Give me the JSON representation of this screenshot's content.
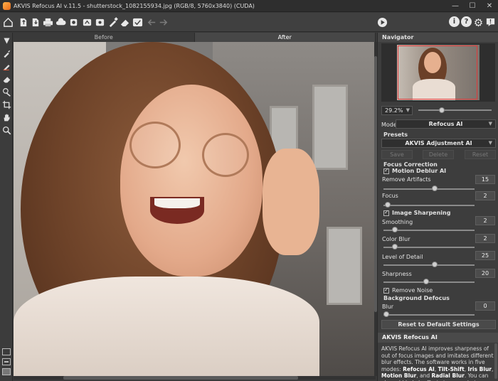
{
  "window": {
    "title": "AKVIS Refocus AI v.11.5 - shutterstock_1082155934.jpg (RGB/8, 5760x3840) (CUDA)",
    "min_glyph": "—",
    "max_glyph": "☐",
    "close_glyph": "✕"
  },
  "toolbar": {
    "icons": [
      "home-icon",
      "open-file-icon",
      "save-file-icon",
      "print-icon",
      "cloud-upload-icon",
      "batch-icon",
      "plugin-icon",
      "preferences-icon",
      "brush-icon",
      "eraser-icon",
      "check-icon",
      "undo-icon",
      "redo-icon",
      "run-icon"
    ],
    "help_buttons": [
      "i",
      "?"
    ],
    "settings_glyph": "⚙",
    "notify_glyph": "!"
  },
  "view_tabs": {
    "before": "Before",
    "after": "After",
    "active": "After"
  },
  "navigator": {
    "title": "Navigator",
    "zoom": "29.2%",
    "zoom_arrow": "▼",
    "zoom_slider_fraction": 0.45
  },
  "settings": {
    "mode_label": "Mode:",
    "mode_value": "Refocus AI",
    "dropdown_arrow": "▼",
    "presets_title": "Presets",
    "preset_value": "AKVIS Adjustment AI",
    "preset_buttons": {
      "save": "Save",
      "delete": "Delete",
      "reset": "Reset"
    },
    "focus_correction_title": "Focus Correction",
    "motion_deblur": {
      "label": "Motion Deblur AI",
      "checked": true
    },
    "remove_artifacts": {
      "label": "Remove Artifacts",
      "value": "15",
      "fraction": 0.55
    },
    "focus": {
      "label": "Focus",
      "value": "2",
      "fraction": 0.02
    },
    "image_sharpening": {
      "label": "Image Sharpening",
      "checked": true
    },
    "smoothing": {
      "label": "Smoothing",
      "value": "2",
      "fraction": 0.1
    },
    "color_blur": {
      "label": "Color Blur",
      "value": "2",
      "fraction": 0.1
    },
    "level_of_detail": {
      "label": "Level of Detail",
      "value": "25",
      "fraction": 0.55
    },
    "sharpness": {
      "label": "Sharpness",
      "value": "20",
      "fraction": 0.45
    },
    "remove_noise": {
      "label": "Remove Noise",
      "checked": true
    },
    "background_defocus_title": "Background Defocus",
    "blur": {
      "label": "Blur",
      "value": "0",
      "fraction": 0.0
    },
    "reset_default": "Reset to Default Settings"
  },
  "info": {
    "title": "AKVIS Refocus AI",
    "text_1": "AKVIS Refocus AI improves sharpness of out of focus images and imitates different blur effects. The software works in five modes: ",
    "mode_1": "Refocus AI",
    "sep_1": ", ",
    "mode_2": "Tilt-Shift",
    "sep_2": ", ",
    "mode_3": "Iris Blur",
    "sep_3": ", ",
    "mode_4": "Motion Blur",
    "sep_4": ", and ",
    "mode_5": "Radial Blur",
    "text_2": ". You can also add bokeh effects to your photos."
  },
  "colors": {
    "panel": "#3d3d3d",
    "frame": "#e53b3b",
    "accent": "#ffb24a"
  }
}
